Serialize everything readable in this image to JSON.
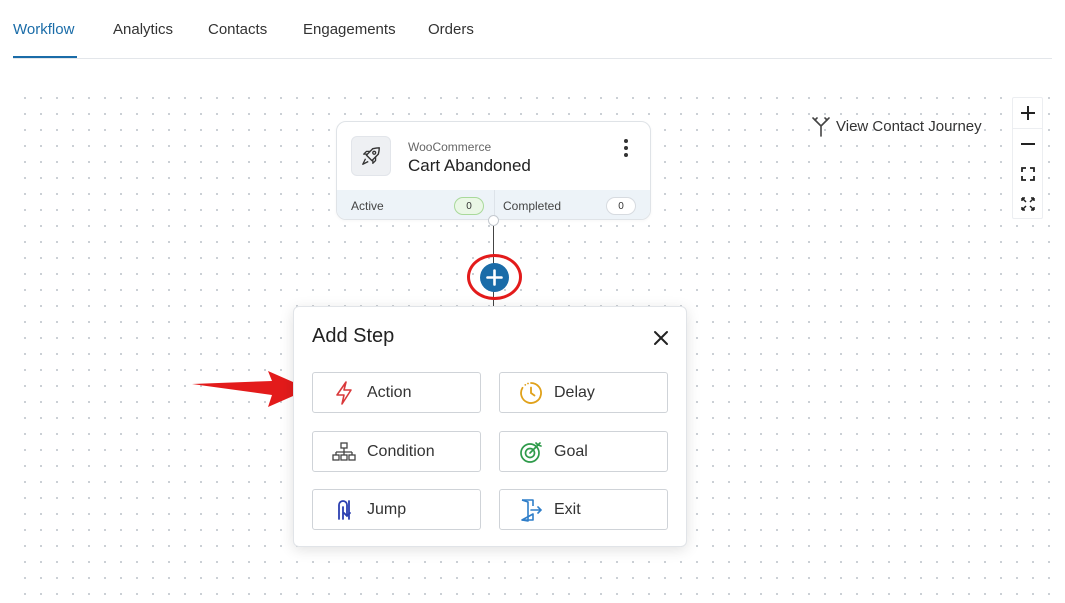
{
  "tabs": [
    {
      "label": "Workflow",
      "active": true
    },
    {
      "label": "Analytics",
      "active": false
    },
    {
      "label": "Contacts",
      "active": false
    },
    {
      "label": "Engagements",
      "active": false
    },
    {
      "label": "Orders",
      "active": false
    }
  ],
  "journey_link": "View Contact Journey",
  "zoom_controls": [
    "zoom-in",
    "zoom-out",
    "fit-to-screen",
    "fullscreen"
  ],
  "trigger": {
    "source": "WooCommerce",
    "title": "Cart Abandoned",
    "icon": "rocket-icon",
    "active_label": "Active",
    "active_count": "0",
    "completed_label": "Completed",
    "completed_count": "0"
  },
  "add_step": {
    "title": "Add Step",
    "options": [
      {
        "label": "Action",
        "icon": "lightning-icon",
        "color": "#d9383a"
      },
      {
        "label": "Delay",
        "icon": "clock-icon",
        "color": "#e0a11a"
      },
      {
        "label": "Condition",
        "icon": "hierarchy-icon",
        "color": "#444444"
      },
      {
        "label": "Goal",
        "icon": "target-icon",
        "color": "#2e9a4a"
      },
      {
        "label": "Jump",
        "icon": "jump-icon",
        "color": "#2b3fb0"
      },
      {
        "label": "Exit",
        "icon": "exit-door-icon",
        "color": "#2f7ec9"
      }
    ]
  },
  "colors": {
    "accent": "#1a6ca8",
    "annotation_red": "#e31b1b",
    "active_badge_bg": "#eaf7e6",
    "active_badge_border": "#a9d99a"
  }
}
